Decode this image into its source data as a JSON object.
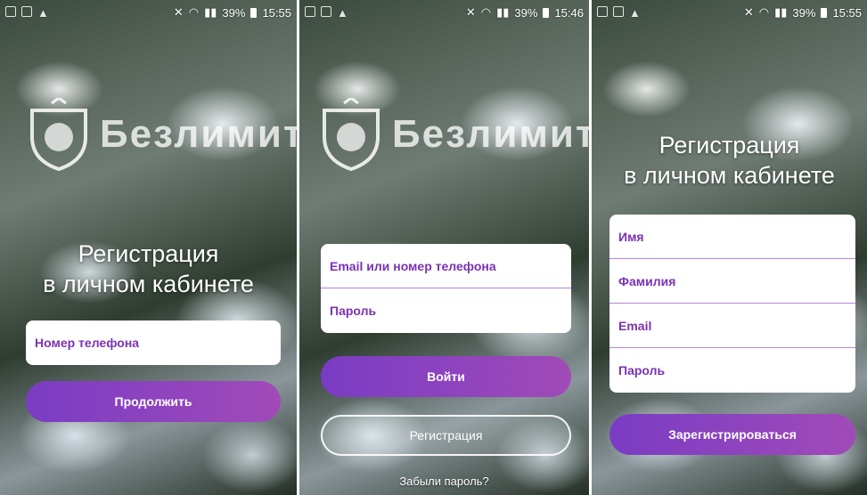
{
  "screens": [
    {
      "status": {
        "battery": "39%",
        "time": "15:55"
      },
      "logo_text": "Безлимит",
      "title_line1": "Регистрация",
      "title_line2": "в личном кабинете",
      "phone_placeholder": "Номер телефона",
      "continue_label": "Продолжить"
    },
    {
      "status": {
        "battery": "39%",
        "time": "15:46"
      },
      "logo_text": "Безлимит",
      "login_placeholder": "Email или номер телефона",
      "password_placeholder": "Пароль",
      "login_label": "Войти",
      "register_label": "Регистрация",
      "forgot_label": "Забыли пароль?"
    },
    {
      "status": {
        "battery": "39%",
        "time": "15:55"
      },
      "title_line1": "Регистрация",
      "title_line2": "в личном кабинете",
      "first_name_placeholder": "Имя",
      "last_name_placeholder": "Фамилия",
      "email_placeholder": "Email",
      "password_placeholder": "Пароль",
      "submit_label": "Зарегистрироваться"
    }
  ],
  "colors": {
    "accent": "#7a32b3",
    "button_start": "#7a3cc4",
    "button_end": "#a14ab8"
  },
  "icons": [
    "sim-icon",
    "warning-icon",
    "mute-icon",
    "wifi-icon",
    "signal-icon",
    "battery-icon",
    "shield-lion-icon"
  ]
}
